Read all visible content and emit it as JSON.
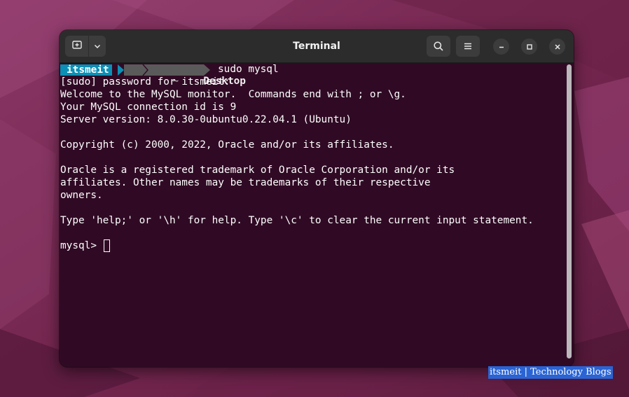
{
  "window": {
    "title": "Terminal"
  },
  "headerbar": {
    "new_tab_icon": "new-tab-icon",
    "menu_arrow_icon": "chevron-down-icon",
    "search_icon": "search-icon",
    "hamburger_icon": "hamburger-menu-icon",
    "minimize_icon": "minimize-icon",
    "maximize_icon": "maximize-icon",
    "close_icon": "close-icon"
  },
  "prompt": {
    "user": "itsmeit",
    "home": "~",
    "directory": "Desktop",
    "command": "sudo mysql"
  },
  "output_lines": [
    "[sudo] password for itsmeit:",
    "Welcome to the MySQL monitor.  Commands end with ; or \\g.",
    "Your MySQL connection id is 9",
    "Server version: 8.0.30-0ubuntu0.22.04.1 (Ubuntu)",
    "",
    "Copyright (c) 2000, 2022, Oracle and/or its affiliates.",
    "",
    "Oracle is a registered trademark of Oracle Corporation and/or its",
    "affiliates. Other names may be trademarks of their respective",
    "owners.",
    "",
    "Type 'help;' or '\\h' for help. Type '\\c' to clear the current input statement.",
    ""
  ],
  "mysql_prompt": "mysql> ",
  "watermark": {
    "text": "itsmeit | Technology Blogs"
  },
  "colors": {
    "terminal_background": "#300a24",
    "headerbar": "#2c2c2c",
    "prompt_user_segment": "#0b8fb5",
    "prompt_dir_segment": "#5a5a5a",
    "desktop_background": "#7a2a57"
  }
}
